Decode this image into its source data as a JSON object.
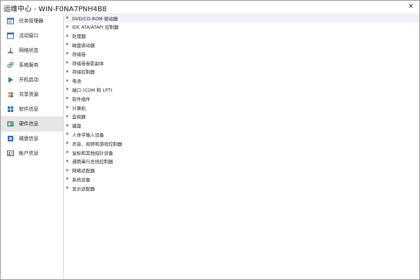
{
  "window": {
    "title": "运维中心 - WIN-F0NA7PNH4B8"
  },
  "sidebar": {
    "items": [
      {
        "label": "任务管理器",
        "icon": "task-manager-icon"
      },
      {
        "label": "活动窗口",
        "icon": "window-icon"
      },
      {
        "label": "网络状态",
        "icon": "network-icon"
      },
      {
        "label": "系统服务",
        "icon": "services-icon"
      },
      {
        "label": "开机启动",
        "icon": "startup-icon"
      },
      {
        "label": "共享资源",
        "icon": "share-icon"
      },
      {
        "label": "软件信息",
        "icon": "software-icon"
      },
      {
        "label": "硬件信息",
        "icon": "hardware-icon"
      },
      {
        "label": "磁盘信息",
        "icon": "disk-icon"
      },
      {
        "label": "帐户信息",
        "icon": "account-icon"
      }
    ],
    "active_label": "硬件信息"
  },
  "device_tree": {
    "categories": [
      "DVD/CD-ROM 驱动器",
      "IDE ATA/ATAPI 控制器",
      "处理器",
      "磁盘驱动器",
      "存储卷",
      "存储卷卷影副本",
      "存储控制器",
      "电池",
      "端口 (COM 和 LPT)",
      "软件组件",
      "计算机",
      "监视器",
      "键盘",
      "人体学输入设备",
      "声音、视频和游戏控制器",
      "鼠标和其他指针设备",
      "通用串行总线控制器",
      "网络适配器",
      "系统设备",
      "显示适配器"
    ],
    "selected_label": "DVD/CD-ROM 驱动器"
  },
  "colors": {
    "selected_nav_bg": "#e6e6e6",
    "selected_row_bg": "#eef2f7",
    "accent_blue": "#2b6cb0",
    "accent_green": "#2e8b57"
  }
}
